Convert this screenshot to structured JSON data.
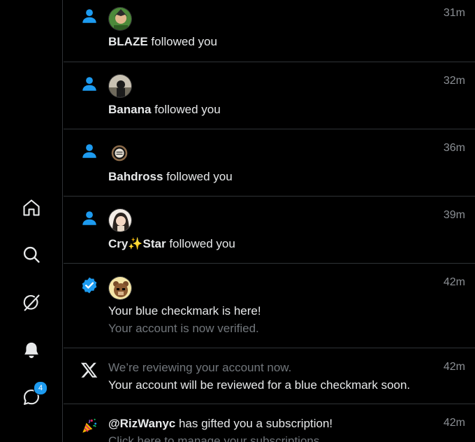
{
  "sidebar": {
    "icons": [
      "home-icon",
      "search-icon",
      "grok-icon",
      "bell-icon",
      "messages-icon"
    ],
    "messages_badge": "4"
  },
  "notifications": [
    {
      "type": "follow",
      "user": "BLAZE",
      "action": " followed you",
      "time": "31m"
    },
    {
      "type": "follow",
      "user": "Banana",
      "action": " followed you",
      "time": "32m"
    },
    {
      "type": "follow",
      "user": "Bahdross",
      "action": " followed you",
      "time": "36m"
    },
    {
      "type": "follow",
      "user": "Cry✨Star",
      "action": " followed you",
      "time": "39m"
    },
    {
      "type": "verified",
      "title": "Your blue checkmark is here!",
      "subtitle": "Your account is now verified.",
      "time": "42m"
    },
    {
      "type": "x",
      "line1": "We’re reviewing your account now.",
      "line2": "Your account will be reviewed for a blue checkmark soon.",
      "time": "42m"
    },
    {
      "type": "gift",
      "user": "@RizWanyc",
      "action": " has gifted you a subscription!",
      "subtitle": "Click here to manage your subscriptions",
      "time": "42m"
    }
  ],
  "colors": {
    "accent": "#1d9bf0",
    "background": "#000000",
    "divider": "#2f3336",
    "muted": "#71767b"
  }
}
